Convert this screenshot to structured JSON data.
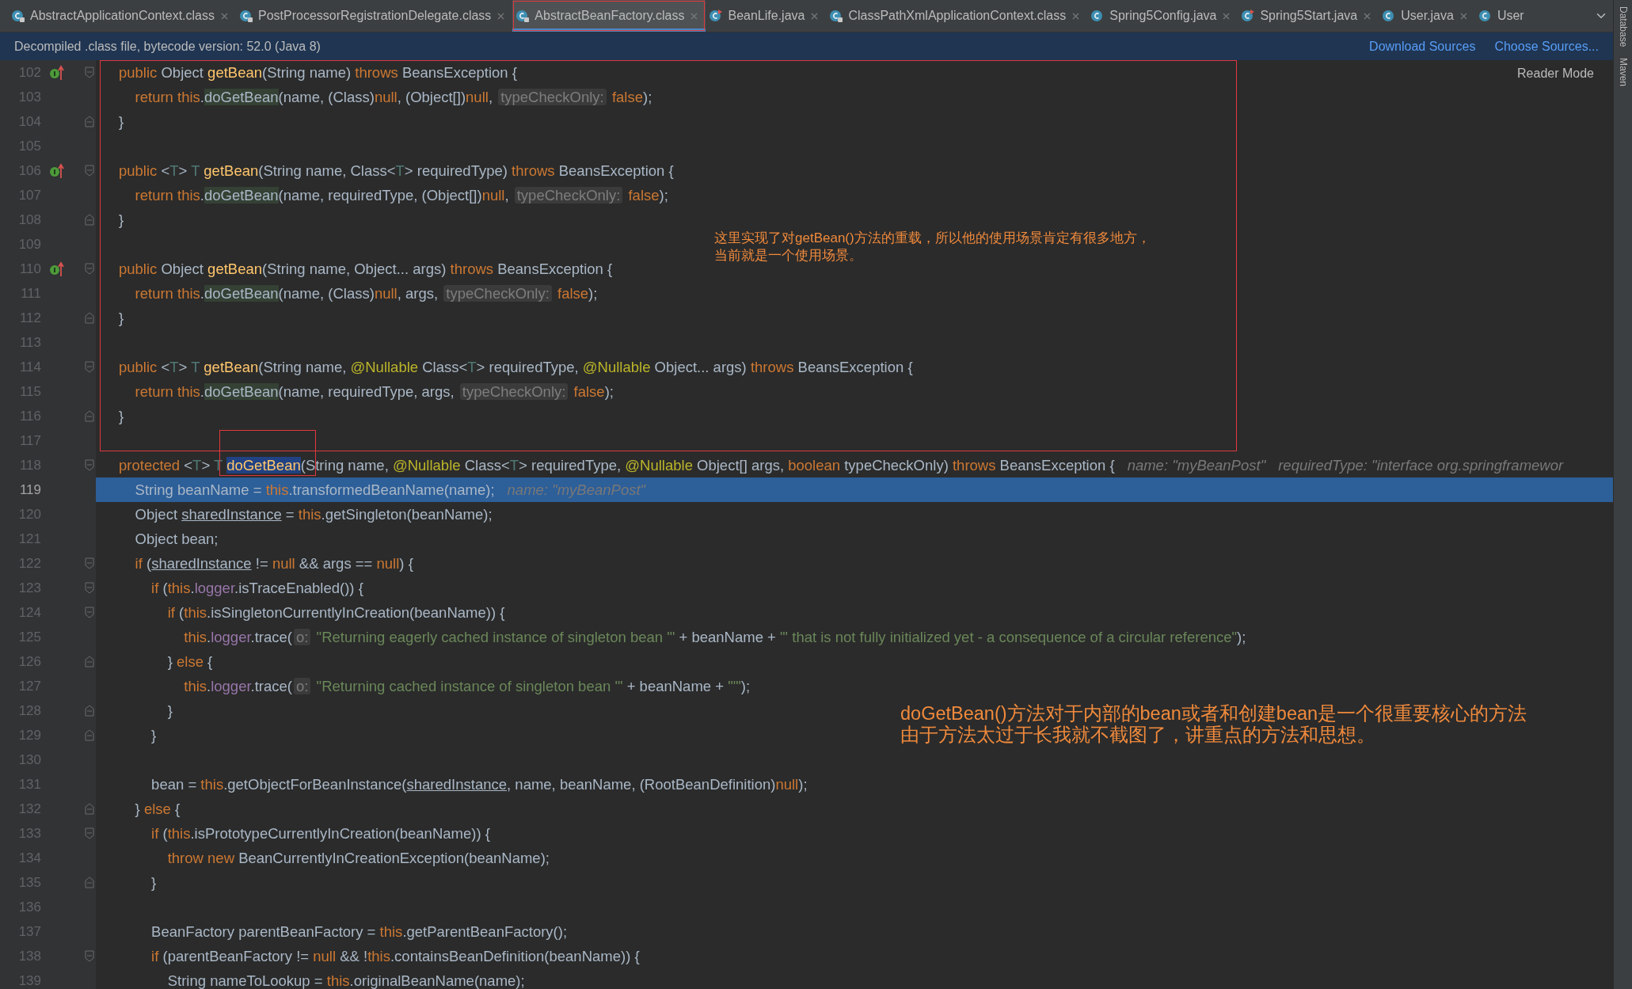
{
  "tabs": [
    {
      "label": "AbstractApplicationContext.class",
      "kind": "class",
      "selected": false,
      "closable": true
    },
    {
      "label": "PostProcessorRegistrationDelegate.class",
      "kind": "class",
      "selected": false,
      "closable": true
    },
    {
      "label": "AbstractBeanFactory.class",
      "kind": "class",
      "selected": true,
      "closable": true
    },
    {
      "label": "BeanLife.java",
      "kind": "runnable",
      "selected": false,
      "closable": true
    },
    {
      "label": "ClassPathXmlApplicationContext.class",
      "kind": "class",
      "selected": false,
      "closable": true
    },
    {
      "label": "Spring5Config.java",
      "kind": "java",
      "selected": false,
      "closable": true
    },
    {
      "label": "Spring5Start.java",
      "kind": "runnable",
      "selected": false,
      "closable": true
    },
    {
      "label": "User.java",
      "kind": "java",
      "selected": false,
      "closable": true
    },
    {
      "label": "User",
      "kind": "java",
      "selected": false,
      "closable": false
    }
  ],
  "banner": {
    "message": "Decompiled .class file, bytecode version: 52.0 (Java 8)",
    "links": [
      "Download Sources",
      "Choose Sources..."
    ]
  },
  "reader_mode": "Reader Mode",
  "side_tools": [
    "Database",
    "Maven"
  ],
  "lines": [
    {
      "number": "102",
      "selected": false,
      "override": true,
      "fold_start": true,
      "fold_end": false,
      "tokens": [
        {
          "kind": "kw",
          "text": "public "
        },
        {
          "kind": "plain",
          "text": "Object "
        },
        {
          "kind": "decl",
          "text": "getBean"
        },
        {
          "kind": "plain",
          "text": "(String name) "
        },
        {
          "kind": "kw",
          "text": "throws "
        },
        {
          "kind": "plain",
          "text": "BeansException {"
        }
      ]
    },
    {
      "number": "103",
      "selected": false,
      "override": false,
      "fold_start": false,
      "fold_end": false,
      "tokens": [
        {
          "kind": "kw",
          "text": "    return this"
        },
        {
          "kind": "plain",
          "text": "."
        },
        {
          "kind": "usage",
          "text": "doGetBean"
        },
        {
          "kind": "plain",
          "text": "(name, (Class)"
        },
        {
          "kind": "kw",
          "text": "null"
        },
        {
          "kind": "plain",
          "text": ", (Object[])"
        },
        {
          "kind": "kw",
          "text": "null"
        },
        {
          "kind": "plain",
          "text": ", "
        },
        {
          "kind": "hint",
          "text": "typeCheckOnly:"
        },
        {
          "kind": "kw",
          "text": " false"
        },
        {
          "kind": "plain",
          "text": ");"
        }
      ]
    },
    {
      "number": "104",
      "selected": false,
      "override": false,
      "fold_start": false,
      "fold_end": true,
      "tokens": [
        {
          "kind": "plain",
          "text": "}"
        }
      ]
    },
    {
      "number": "105",
      "selected": false,
      "override": false,
      "fold_start": false,
      "fold_end": false
    },
    {
      "number": "106",
      "selected": false,
      "override": true,
      "fold_start": true,
      "fold_end": false,
      "tokens": [
        {
          "kind": "kw",
          "text": "public "
        },
        {
          "kind": "plain",
          "text": "<"
        },
        {
          "kind": "tparam",
          "text": "T"
        },
        {
          "kind": "plain",
          "text": "> "
        },
        {
          "kind": "tparam",
          "text": "T "
        },
        {
          "kind": "decl",
          "text": "getBean"
        },
        {
          "kind": "plain",
          "text": "(String name, Class<"
        },
        {
          "kind": "tparam",
          "text": "T"
        },
        {
          "kind": "plain",
          "text": "> requiredType) "
        },
        {
          "kind": "kw",
          "text": "throws "
        },
        {
          "kind": "plain",
          "text": "BeansException {"
        }
      ]
    },
    {
      "number": "107",
      "selected": false,
      "override": false,
      "fold_start": false,
      "fold_end": false,
      "tokens": [
        {
          "kind": "kw",
          "text": "    return this"
        },
        {
          "kind": "plain",
          "text": "."
        },
        {
          "kind": "usage",
          "text": "doGetBean"
        },
        {
          "kind": "plain",
          "text": "(name, requiredType, (Object[])"
        },
        {
          "kind": "kw",
          "text": "null"
        },
        {
          "kind": "plain",
          "text": ", "
        },
        {
          "kind": "hint",
          "text": "typeCheckOnly:"
        },
        {
          "kind": "kw",
          "text": " false"
        },
        {
          "kind": "plain",
          "text": ");"
        }
      ]
    },
    {
      "number": "108",
      "selected": false,
      "override": false,
      "fold_start": false,
      "fold_end": true,
      "tokens": [
        {
          "kind": "plain",
          "text": "}"
        }
      ]
    },
    {
      "number": "109",
      "selected": false,
      "override": false,
      "fold_start": false,
      "fold_end": false
    },
    {
      "number": "110",
      "selected": false,
      "override": true,
      "fold_start": true,
      "fold_end": false,
      "tokens": [
        {
          "kind": "kw",
          "text": "public "
        },
        {
          "kind": "plain",
          "text": "Object "
        },
        {
          "kind": "decl",
          "text": "getBean"
        },
        {
          "kind": "plain",
          "text": "(String name, Object... args) "
        },
        {
          "kind": "kw",
          "text": "throws "
        },
        {
          "kind": "plain",
          "text": "BeansException {"
        }
      ]
    },
    {
      "number": "111",
      "selected": false,
      "override": false,
      "fold_start": false,
      "fold_end": false,
      "tokens": [
        {
          "kind": "kw",
          "text": "    return this"
        },
        {
          "kind": "plain",
          "text": "."
        },
        {
          "kind": "usage",
          "text": "doGetBean"
        },
        {
          "kind": "plain",
          "text": "(name, (Class)"
        },
        {
          "kind": "kw",
          "text": "null"
        },
        {
          "kind": "plain",
          "text": ", args, "
        },
        {
          "kind": "hint",
          "text": "typeCheckOnly:"
        },
        {
          "kind": "kw",
          "text": " false"
        },
        {
          "kind": "plain",
          "text": ");"
        }
      ]
    },
    {
      "number": "112",
      "selected": false,
      "override": false,
      "fold_start": false,
      "fold_end": true,
      "tokens": [
        {
          "kind": "plain",
          "text": "}"
        }
      ]
    },
    {
      "number": "113",
      "selected": false,
      "override": false,
      "fold_start": false,
      "fold_end": false
    },
    {
      "number": "114",
      "selected": false,
      "override": false,
      "fold_start": true,
      "fold_end": false,
      "tokens": [
        {
          "kind": "kw",
          "text": "public "
        },
        {
          "kind": "plain",
          "text": "<"
        },
        {
          "kind": "tparam",
          "text": "T"
        },
        {
          "kind": "plain",
          "text": "> "
        },
        {
          "kind": "tparam",
          "text": "T "
        },
        {
          "kind": "decl",
          "text": "getBean"
        },
        {
          "kind": "plain",
          "text": "(String name, "
        },
        {
          "kind": "ann",
          "text": "@Nullable "
        },
        {
          "kind": "plain",
          "text": "Class<"
        },
        {
          "kind": "tparam",
          "text": "T"
        },
        {
          "kind": "plain",
          "text": "> requiredType, "
        },
        {
          "kind": "ann",
          "text": "@Nullable "
        },
        {
          "kind": "plain",
          "text": "Object... args) "
        },
        {
          "kind": "kw",
          "text": "throws "
        },
        {
          "kind": "plain",
          "text": "BeansException {"
        }
      ]
    },
    {
      "number": "115",
      "selected": false,
      "override": false,
      "fold_start": false,
      "fold_end": false,
      "tokens": [
        {
          "kind": "kw",
          "text": "    return this"
        },
        {
          "kind": "plain",
          "text": "."
        },
        {
          "kind": "usage",
          "text": "doGetBean"
        },
        {
          "kind": "plain",
          "text": "(name, requiredType, args, "
        },
        {
          "kind": "hint",
          "text": "typeCheckOnly:"
        },
        {
          "kind": "kw",
          "text": " false"
        },
        {
          "kind": "plain",
          "text": ");"
        }
      ]
    },
    {
      "number": "116",
      "selected": false,
      "override": false,
      "fold_start": false,
      "fold_end": true,
      "tokens": [
        {
          "kind": "plain",
          "text": "}"
        }
      ]
    },
    {
      "number": "117",
      "selected": false,
      "override": false,
      "fold_start": false,
      "fold_end": false
    },
    {
      "number": "118",
      "selected": false,
      "override": false,
      "fold_start": true,
      "fold_end": false,
      "tokens": [
        {
          "kind": "kw",
          "text": "protected "
        },
        {
          "kind": "plain",
          "text": "<"
        },
        {
          "kind": "tparam",
          "text": "T"
        },
        {
          "kind": "plain",
          "text": "> "
        },
        {
          "kind": "tparam",
          "text": "T "
        },
        {
          "kind": "sel",
          "text": "doGetBean"
        },
        {
          "kind": "plain",
          "text": "(String name, "
        },
        {
          "kind": "ann",
          "text": "@Nullable "
        },
        {
          "kind": "plain",
          "text": "Class<"
        },
        {
          "kind": "tparam",
          "text": "T"
        },
        {
          "kind": "plain",
          "text": "> requiredType, "
        },
        {
          "kind": "ann",
          "text": "@Nullable "
        },
        {
          "kind": "plain",
          "text": "Object[] args, "
        },
        {
          "kind": "kw",
          "text": "boolean "
        },
        {
          "kind": "plain",
          "text": "typeCheckOnly) "
        },
        {
          "kind": "kw",
          "text": "throws "
        },
        {
          "kind": "plain",
          "text": "BeansException {"
        },
        {
          "kind": "debug",
          "text": "name: \"myBeanPost\""
        },
        {
          "kind": "debug",
          "text": "requiredType: \"interface org.springframewor"
        }
      ]
    },
    {
      "number": "119",
      "selected": true,
      "override": false,
      "fold_start": false,
      "fold_end": false,
      "tokens": [
        {
          "kind": "plain",
          "text": "    String beanName = "
        },
        {
          "kind": "kw",
          "text": "this"
        },
        {
          "kind": "plain",
          "text": ".transformedBeanName(name);"
        },
        {
          "kind": "debug",
          "text": "name: \"myBeanPost\""
        }
      ]
    },
    {
      "number": "120",
      "selected": false,
      "override": false,
      "fold_start": false,
      "fold_end": false,
      "tokens": [
        {
          "kind": "plain",
          "text": "    Object "
        },
        {
          "kind": "under",
          "text": "sharedInstance"
        },
        {
          "kind": "plain",
          "text": " = "
        },
        {
          "kind": "kw",
          "text": "this"
        },
        {
          "kind": "plain",
          "text": ".getSingleton(beanName);"
        }
      ]
    },
    {
      "number": "121",
      "selected": false,
      "override": false,
      "fold_start": false,
      "fold_end": false,
      "tokens": [
        {
          "kind": "plain",
          "text": "    Object bean;"
        }
      ]
    },
    {
      "number": "122",
      "selected": false,
      "override": false,
      "fold_start": true,
      "fold_end": false,
      "tokens": [
        {
          "kind": "kw",
          "text": "    if "
        },
        {
          "kind": "plain",
          "text": "("
        },
        {
          "kind": "under",
          "text": "sharedInstance"
        },
        {
          "kind": "plain",
          "text": " != "
        },
        {
          "kind": "kw",
          "text": "null"
        },
        {
          "kind": "plain",
          "text": " && args == "
        },
        {
          "kind": "kw",
          "text": "null"
        },
        {
          "kind": "plain",
          "text": ") {"
        }
      ]
    },
    {
      "number": "123",
      "selected": false,
      "override": false,
      "fold_start": true,
      "fold_end": false,
      "tokens": [
        {
          "kind": "kw",
          "text": "        if "
        },
        {
          "kind": "plain",
          "text": "("
        },
        {
          "kind": "kw",
          "text": "this"
        },
        {
          "kind": "plain",
          "text": "."
        },
        {
          "kind": "field",
          "text": "logger"
        },
        {
          "kind": "plain",
          "text": ".isTraceEnabled()) {"
        }
      ]
    },
    {
      "number": "124",
      "selected": false,
      "override": false,
      "fold_start": true,
      "fold_end": false,
      "tokens": [
        {
          "kind": "kw",
          "text": "            if "
        },
        {
          "kind": "plain",
          "text": "("
        },
        {
          "kind": "kw",
          "text": "this"
        },
        {
          "kind": "plain",
          "text": ".isSingletonCurrentlyInCreation(beanName)) {"
        }
      ]
    },
    {
      "number": "125",
      "selected": false,
      "override": false,
      "fold_start": false,
      "fold_end": false,
      "tokens": [
        {
          "kind": "kw",
          "text": "                this"
        },
        {
          "kind": "plain",
          "text": "."
        },
        {
          "kind": "field",
          "text": "logger"
        },
        {
          "kind": "plain",
          "text": ".trace("
        },
        {
          "kind": "hint",
          "text": "o:"
        },
        {
          "kind": "str",
          "text": " \"Returning eagerly cached instance of singleton bean '\""
        },
        {
          "kind": "plain",
          "text": " + beanName + "
        },
        {
          "kind": "str",
          "text": "\"' that is not fully initialized yet - a consequence of a circular reference\""
        },
        {
          "kind": "plain",
          "text": ");"
        }
      ]
    },
    {
      "number": "126",
      "selected": false,
      "override": false,
      "fold_start": false,
      "fold_end": true,
      "tokens": [
        {
          "kind": "plain",
          "text": "            } "
        },
        {
          "kind": "kw",
          "text": "else "
        },
        {
          "kind": "plain",
          "text": "{"
        }
      ]
    },
    {
      "number": "127",
      "selected": false,
      "override": false,
      "fold_start": false,
      "fold_end": false,
      "tokens": [
        {
          "kind": "kw",
          "text": "                this"
        },
        {
          "kind": "plain",
          "text": "."
        },
        {
          "kind": "field",
          "text": "logger"
        },
        {
          "kind": "plain",
          "text": ".trace("
        },
        {
          "kind": "hint",
          "text": "o:"
        },
        {
          "kind": "str",
          "text": " \"Returning cached instance of singleton bean '\""
        },
        {
          "kind": "plain",
          "text": " + beanName + "
        },
        {
          "kind": "str",
          "text": "\"'\""
        },
        {
          "kind": "plain",
          "text": ");"
        }
      ]
    },
    {
      "number": "128",
      "selected": false,
      "override": false,
      "fold_start": false,
      "fold_end": true,
      "tokens": [
        {
          "kind": "plain",
          "text": "            }"
        }
      ]
    },
    {
      "number": "129",
      "selected": false,
      "override": false,
      "fold_start": false,
      "fold_end": true,
      "tokens": [
        {
          "kind": "plain",
          "text": "        }"
        }
      ]
    },
    {
      "number": "130",
      "selected": false,
      "override": false,
      "fold_start": false,
      "fold_end": false
    },
    {
      "number": "131",
      "selected": false,
      "override": false,
      "fold_start": false,
      "fold_end": false,
      "tokens": [
        {
          "kind": "plain",
          "text": "        bean = "
        },
        {
          "kind": "kw",
          "text": "this"
        },
        {
          "kind": "plain",
          "text": ".getObjectForBeanInstance("
        },
        {
          "kind": "under",
          "text": "sharedInstance"
        },
        {
          "kind": "plain",
          "text": ", name, beanName, (RootBeanDefinition)"
        },
        {
          "kind": "kw",
          "text": "null"
        },
        {
          "kind": "plain",
          "text": ");"
        }
      ]
    },
    {
      "number": "132",
      "selected": false,
      "override": false,
      "fold_start": false,
      "fold_end": true,
      "tokens": [
        {
          "kind": "plain",
          "text": "    } "
        },
        {
          "kind": "kw",
          "text": "else "
        },
        {
          "kind": "plain",
          "text": "{"
        }
      ]
    },
    {
      "number": "133",
      "selected": false,
      "override": false,
      "fold_start": true,
      "fold_end": false,
      "tokens": [
        {
          "kind": "kw",
          "text": "        if "
        },
        {
          "kind": "plain",
          "text": "("
        },
        {
          "kind": "kw",
          "text": "this"
        },
        {
          "kind": "plain",
          "text": ".isPrototypeCurrentlyInCreation(beanName)) {"
        }
      ]
    },
    {
      "number": "134",
      "selected": false,
      "override": false,
      "fold_start": false,
      "fold_end": false,
      "tokens": [
        {
          "kind": "kw",
          "text": "            throw new "
        },
        {
          "kind": "plain",
          "text": "BeanCurrentlyInCreationException(beanName);"
        }
      ]
    },
    {
      "number": "135",
      "selected": false,
      "override": false,
      "fold_start": false,
      "fold_end": true,
      "tokens": [
        {
          "kind": "plain",
          "text": "        }"
        }
      ]
    },
    {
      "number": "136",
      "selected": false,
      "override": false,
      "fold_start": false,
      "fold_end": false
    },
    {
      "number": "137",
      "selected": false,
      "override": false,
      "fold_start": false,
      "fold_end": false,
      "tokens": [
        {
          "kind": "plain",
          "text": "        BeanFactory parentBeanFactory = "
        },
        {
          "kind": "kw",
          "text": "this"
        },
        {
          "kind": "plain",
          "text": ".getParentBeanFactory();"
        }
      ]
    },
    {
      "number": "138",
      "selected": false,
      "override": false,
      "fold_start": true,
      "fold_end": false,
      "tokens": [
        {
          "kind": "kw",
          "text": "        if "
        },
        {
          "kind": "plain",
          "text": "(parentBeanFactory != "
        },
        {
          "kind": "kw",
          "text": "null"
        },
        {
          "kind": "plain",
          "text": " && !"
        },
        {
          "kind": "kw",
          "text": "this"
        },
        {
          "kind": "plain",
          "text": ".containsBeanDefinition(beanName)) {"
        }
      ]
    },
    {
      "number": "139",
      "selected": false,
      "override": false,
      "fold_start": false,
      "fold_end": false,
      "tokens": [
        {
          "kind": "plain",
          "text": "            String nameToLookup = "
        },
        {
          "kind": "kw",
          "text": "this"
        },
        {
          "kind": "plain",
          "text": ".originalBeanName(name);"
        }
      ]
    }
  ],
  "notes": [
    {
      "kind": "small",
      "lines": [
        "这里实现了对getBean()方法的重载，所以他的使用场景肯定有很多地方，",
        "当前就是一个使用场景。"
      ]
    },
    {
      "kind": "large",
      "lines": [
        "doGetBean()方法对于内部的bean或者和创建bean是一个很重要核心的方法",
        "由于方法太过于长我就不截图了，讲重点的方法和思想。"
      ]
    }
  ]
}
